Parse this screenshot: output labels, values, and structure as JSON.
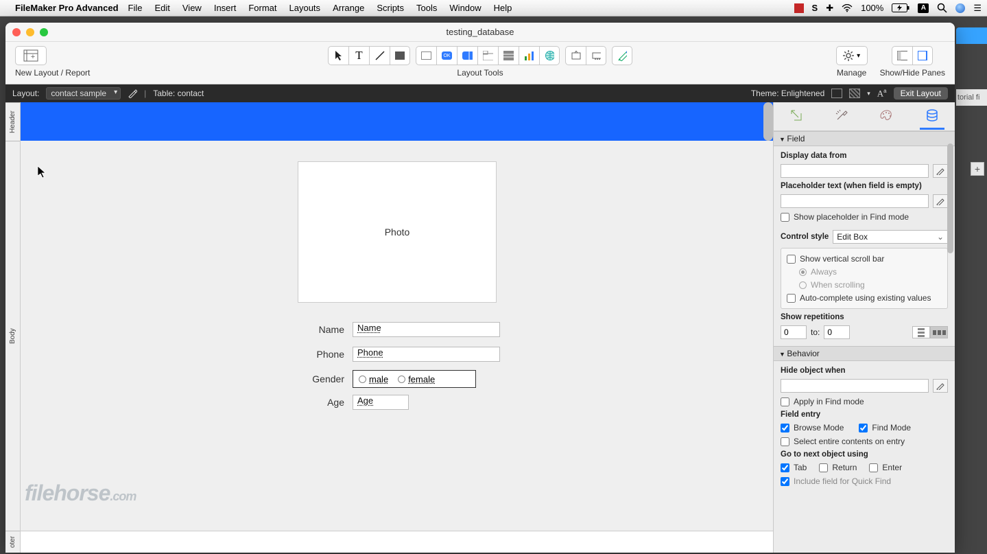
{
  "menus": {
    "app": "FileMaker Pro Advanced",
    "items": [
      "File",
      "Edit",
      "View",
      "Insert",
      "Format",
      "Layouts",
      "Arrange",
      "Scripts",
      "Tools",
      "Window",
      "Help"
    ],
    "battery": "100%"
  },
  "window": {
    "title": "testing_database"
  },
  "toolbar": {
    "left_label": "New Layout / Report",
    "center_label": "Layout Tools",
    "manage_label": "Manage",
    "panes_label": "Show/Hide Panes"
  },
  "layoutbar": {
    "layout_lbl": "Layout:",
    "layout_val": "contact sample",
    "table_lbl": "Table: contact",
    "theme_lbl": "Theme: Enlightened",
    "exit": "Exit Layout"
  },
  "parts": {
    "header": "Header",
    "body": "Body",
    "footer": "oter"
  },
  "canvas": {
    "photo": "Photo",
    "name_lbl": "Name",
    "name_val": "Name",
    "phone_lbl": "Phone",
    "phone_val": "Phone",
    "gender_lbl": "Gender",
    "gender_opts": [
      "male",
      "female"
    ],
    "age_lbl": "Age",
    "age_val": "Age"
  },
  "watermark": {
    "a": "filehorse",
    "b": ".com"
  },
  "inspector": {
    "tabs": [
      "ruler",
      "tools",
      "palette",
      "data"
    ],
    "sec_field": "Field",
    "display_lbl": "Display data from",
    "placeholder_lbl": "Placeholder text (when field is empty)",
    "show_ph": "Show placeholder in Find mode",
    "ctrl_lbl": "Control style",
    "ctrl_val": "Edit Box",
    "scrollbar": "Show vertical scroll bar",
    "always": "Always",
    "when_scroll": "When scrolling",
    "autocomplete": "Auto-complete using existing values",
    "rep_lbl": "Show repetitions",
    "rep_from": "0",
    "rep_to_lbl": "to:",
    "rep_to": "0",
    "sec_behavior": "Behavior",
    "hide_lbl": "Hide object when",
    "apply_find": "Apply in Find mode",
    "field_entry": "Field entry",
    "browse": "Browse Mode",
    "find": "Find Mode",
    "select_entire": "Select entire contents on entry",
    "goto_lbl": "Go to next object using",
    "tab": "Tab",
    "return": "Return",
    "enter": "Enter",
    "quickfind": "Include field for Quick Find"
  },
  "bg": {
    "strip": "torial fi"
  }
}
